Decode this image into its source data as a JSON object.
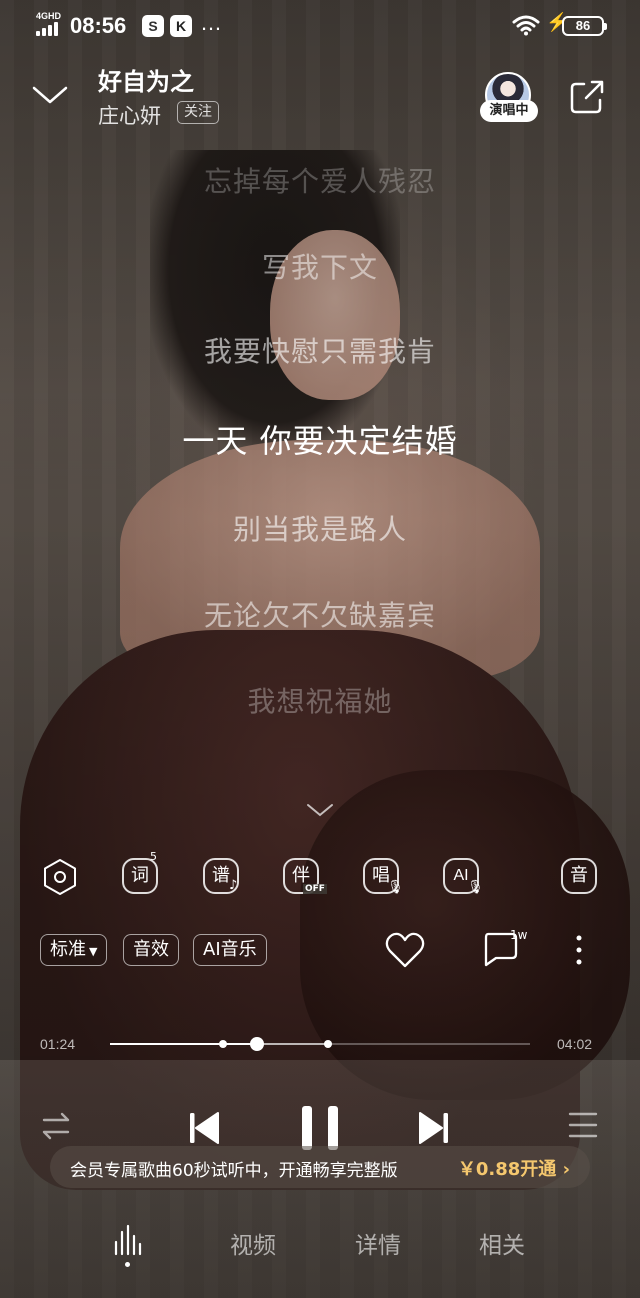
{
  "status_bar": {
    "network": "4GHD",
    "time": "08:56",
    "app_icons": [
      "S",
      "K"
    ],
    "more": "…",
    "battery": "86"
  },
  "header": {
    "song_title": "好自为之",
    "artist": "庄心妍",
    "follow_label": "关注",
    "live_badge": "演唱中"
  },
  "lyrics": {
    "lines": [
      "忘掉每个爱人残忍",
      "写我下文",
      "我要快慰只需我肯",
      "一天 你要决定结婚",
      "别当我是路人",
      "无论欠不欠缺嘉宾",
      "我想祝福她"
    ],
    "current_index": 3
  },
  "tools": {
    "lyrics_label": "词",
    "lyrics_count": "5",
    "score_label": "谱",
    "accompany_label": "伴",
    "accompany_state": "OFF",
    "sing_label": "唱",
    "ai_label": "AI",
    "sound_label": "音"
  },
  "chips": {
    "quality": "标准",
    "effects": "音效",
    "ai_music": "AI音乐"
  },
  "social": {
    "comment_count": "1w"
  },
  "progress": {
    "elapsed": "01:24",
    "duration": "04:02",
    "fraction": 0.35,
    "buffer_fraction": 0.52,
    "preview_start_fraction": 0.27
  },
  "vip_banner": {
    "message": "会员专属歌曲60秒试听中，开通畅享完整版",
    "price": "￥0.88开通",
    "chevron": "›"
  },
  "tabs": {
    "video": "视频",
    "details": "详情",
    "related": "相关"
  },
  "colors": {
    "accent_price": "#f5c76e",
    "text": "#ffffff"
  }
}
